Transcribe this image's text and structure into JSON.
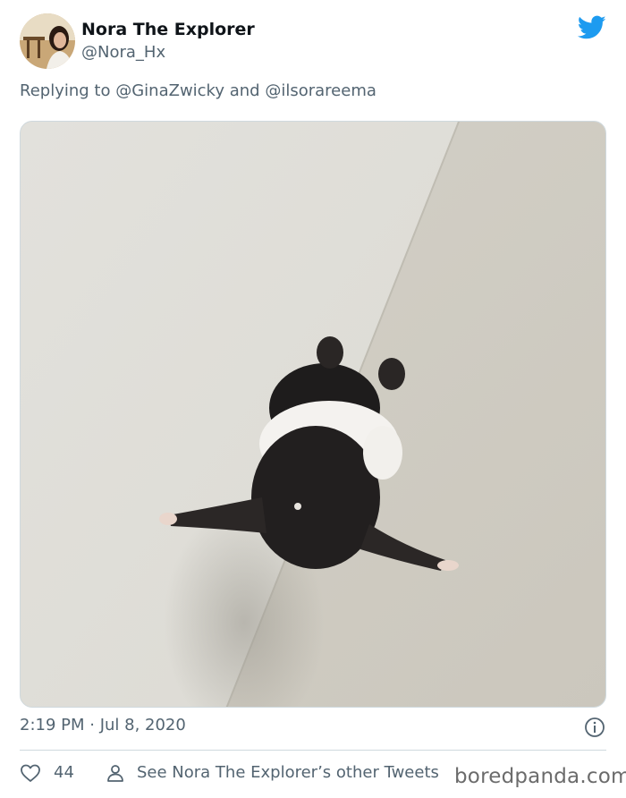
{
  "tweet": {
    "author_name": "Nora The Explorer",
    "author_handle": "@Nora_Hx",
    "replying_prefix": "Replying to",
    "reply_to_1": "@GinaZwicky",
    "reply_joiner": "and",
    "reply_to_2": "@ilsorareema",
    "timestamp": "2:19 PM · Jul 8, 2020",
    "like_count": "44",
    "other_tweets_label": "See Nora The Explorer’s other Tweets"
  },
  "watermark": "boredpanda.com",
  "colors": {
    "twitter_blue": "#1d9bf0",
    "secondary_text": "#536471",
    "divider": "#cfd9de"
  },
  "icons": {
    "logo": "twitter-bird-icon",
    "info": "info-icon",
    "like": "heart-icon",
    "profile": "person-icon"
  }
}
